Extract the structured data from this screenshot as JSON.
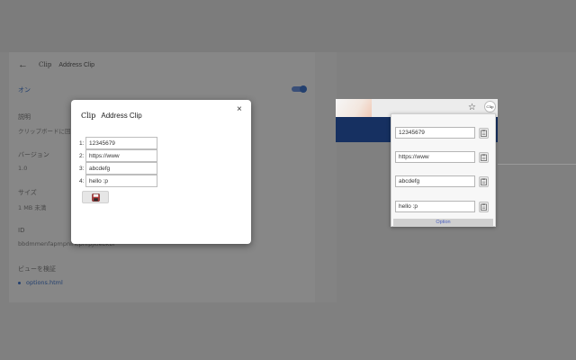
{
  "background_page": {
    "header": {
      "logo": "Clip",
      "title": "Address Clip"
    },
    "toggle_label": "オン",
    "sections": [
      {
        "label": "説明",
        "value": "クリップボードに回"
      },
      {
        "label": "バージョン",
        "value": "1.0"
      },
      {
        "label": "サイズ",
        "value": "1 MB 未満"
      },
      {
        "label": "ID",
        "value": "bbdmmenfapmpnlhcpnfpjklebkbl"
      },
      {
        "label": "ビューを検証",
        "value": "options.html"
      }
    ]
  },
  "dialog": {
    "logo": "Clip",
    "title": "Address Clip",
    "close": "×",
    "rows": [
      {
        "num": "1:",
        "value": "12345679"
      },
      {
        "num": "2:",
        "value": "https://www"
      },
      {
        "num": "3:",
        "value": "abcdefg"
      },
      {
        "num": "4:",
        "value": "hello :p"
      }
    ]
  },
  "browser": {
    "star": "☆",
    "ext_icon_label": "Clip"
  },
  "popup": {
    "rows": [
      {
        "value": "12345679"
      },
      {
        "value": "https://www"
      },
      {
        "value": "abcdefg"
      },
      {
        "value": "hello :p"
      }
    ],
    "option_label": "Option"
  },
  "icons": {
    "back": "arrow-left-icon",
    "close": "close-icon",
    "save": "floppy-disk-icon",
    "copy": "clipboard-icon",
    "star": "star-icon"
  },
  "colors": {
    "accent": "#23406f",
    "option_link": "#4a5fbf",
    "overlay": "#808080"
  }
}
